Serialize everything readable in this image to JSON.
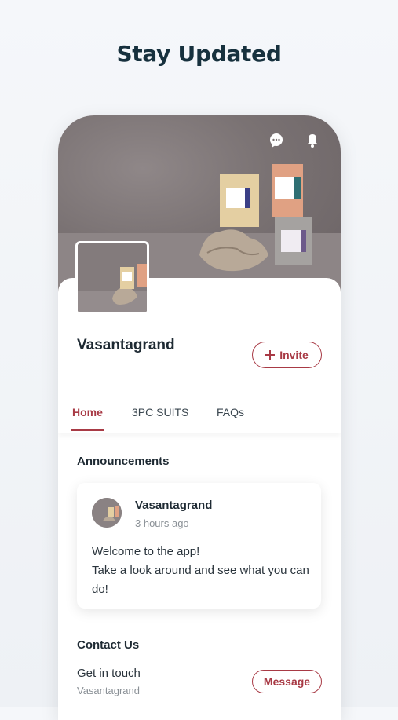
{
  "headline": "Stay Updated",
  "colors": {
    "accent": "#a83a45",
    "text_dark": "#1e2a33",
    "text_muted": "#8a9096"
  },
  "header": {
    "icons": [
      "chat-icon",
      "bell-icon"
    ]
  },
  "profile": {
    "name": "Vasantagrand",
    "invite_label": "Invite"
  },
  "tabs": [
    {
      "label": "Home",
      "active": true
    },
    {
      "label": "3PC SUITS",
      "active": false
    },
    {
      "label": "FAQs",
      "active": false
    }
  ],
  "announcements": {
    "title": "Announcements",
    "post": {
      "author": "Vasantagrand",
      "time": "3 hours ago",
      "line1": "Welcome to the app!",
      "line2": "Take a look around and see what you can do!"
    }
  },
  "contact": {
    "title": "Contact Us",
    "line": "Get in touch",
    "sub": "Vasantagrand",
    "message_label": "Message"
  }
}
